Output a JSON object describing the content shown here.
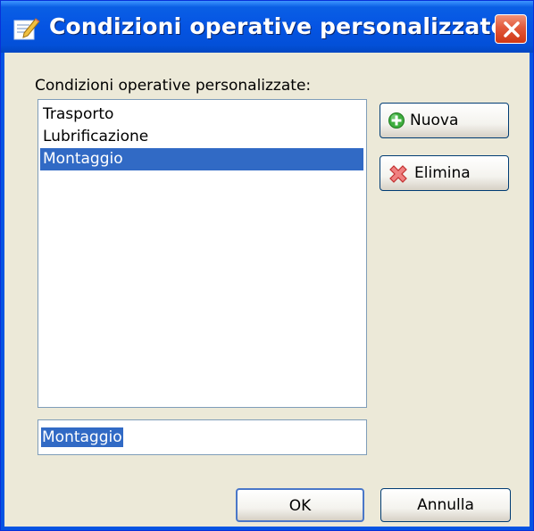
{
  "window": {
    "title": "Condizioni operative personalizzate",
    "title_icon": "edit-icon",
    "close_icon": "close-icon",
    "accent": "#0554e3"
  },
  "list": {
    "label": "Condizioni operative personalizzate:",
    "items": [
      "Trasporto",
      "Lubrificazione",
      "Montaggio"
    ],
    "selected": "Montaggio"
  },
  "actions": {
    "new_label": "Nuova",
    "new_icon": "add-icon",
    "delete_label": "Elimina",
    "delete_icon": "delete-icon"
  },
  "name_field": {
    "value": "Montaggio"
  },
  "footer": {
    "ok_label": "OK",
    "cancel_label": "Annulla"
  }
}
